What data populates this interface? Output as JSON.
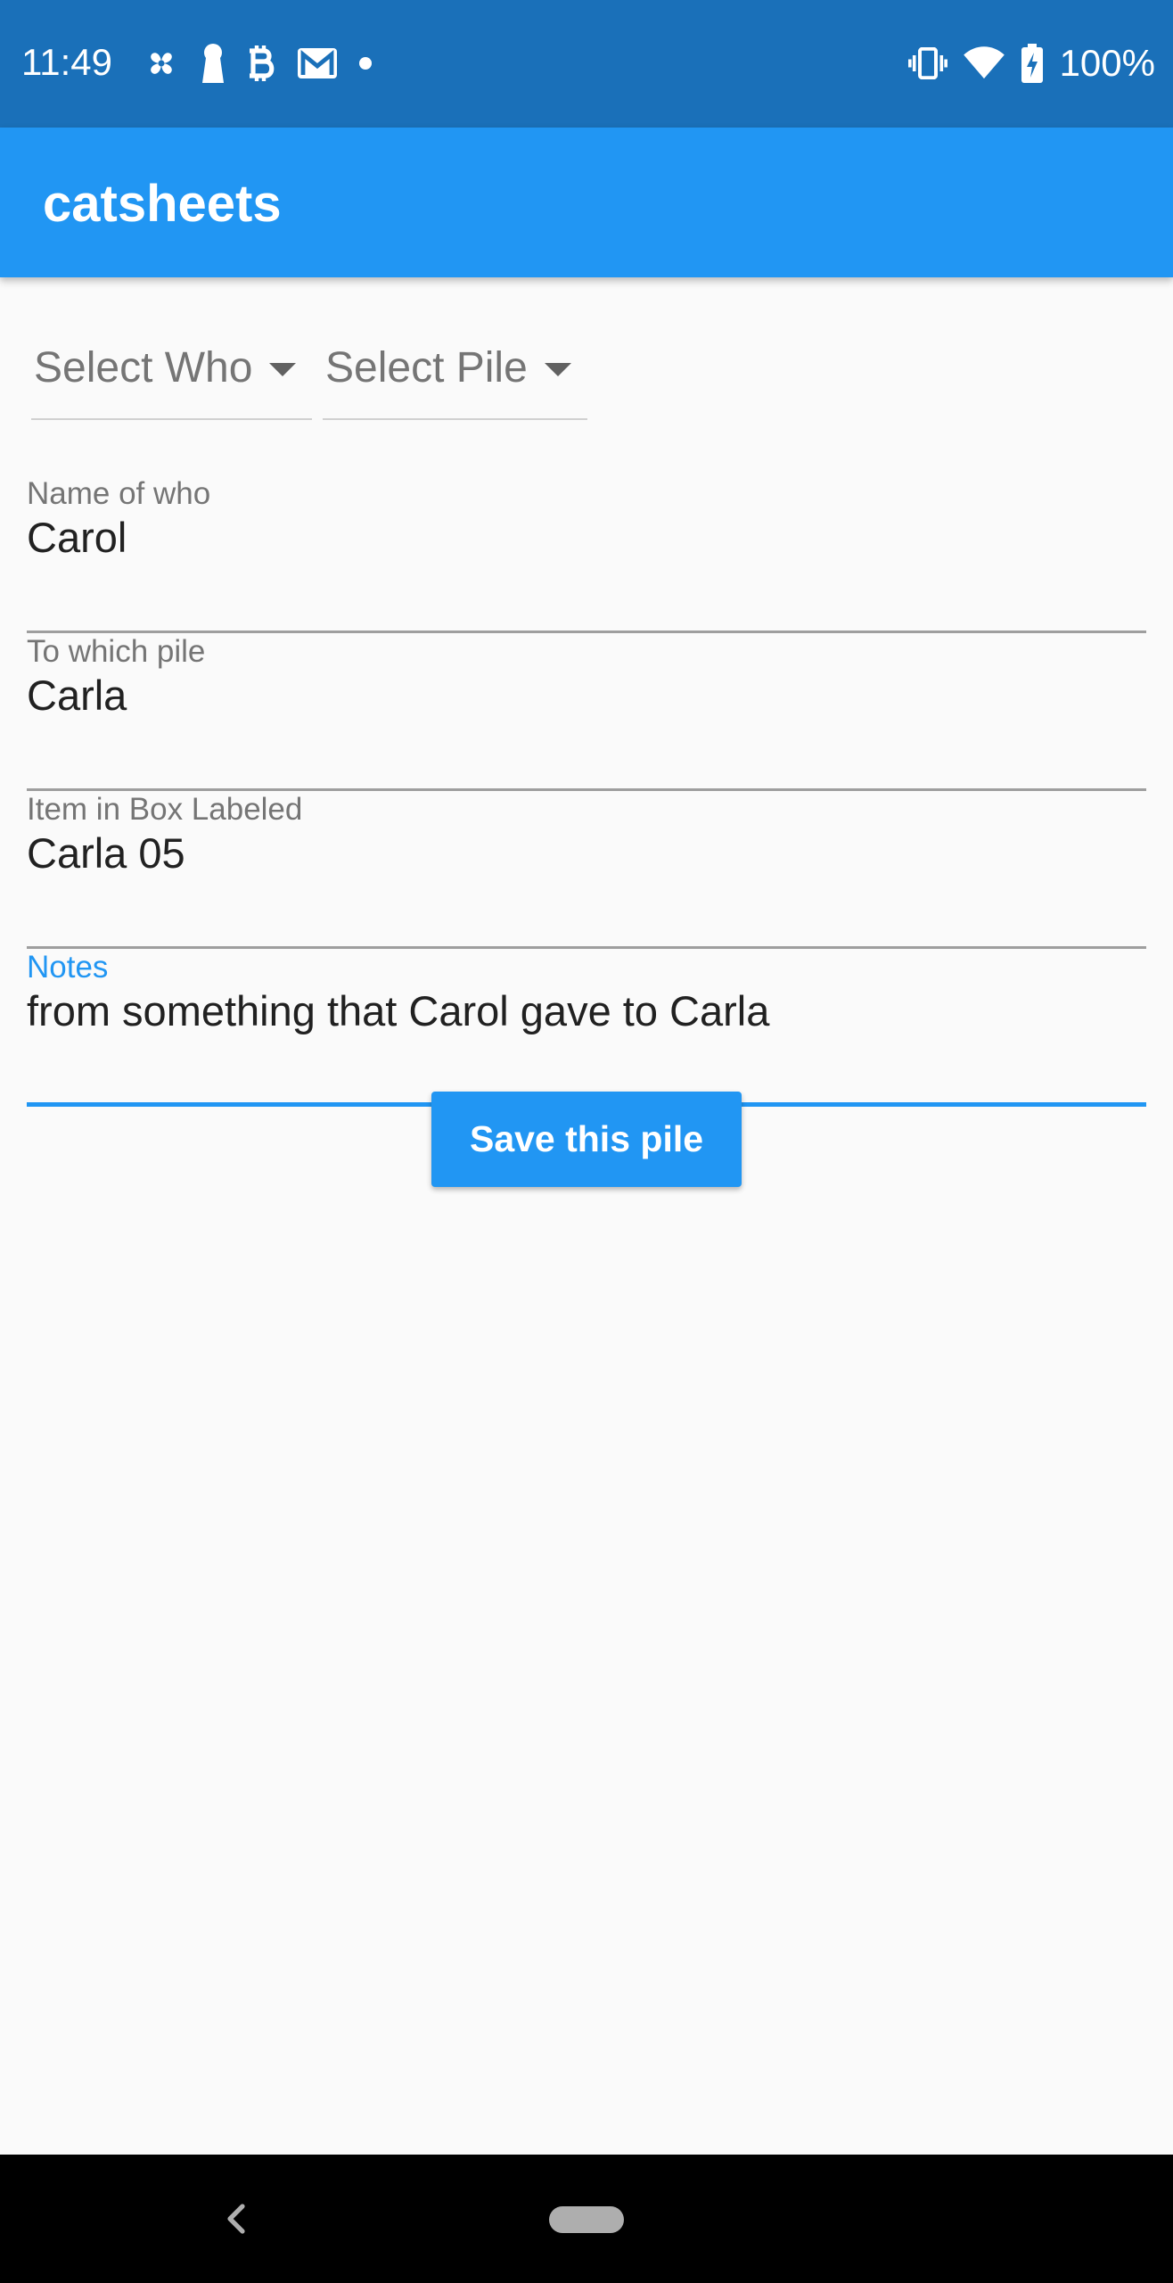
{
  "status_bar": {
    "time": "11:49",
    "left_icons": [
      "pinwheel-icon",
      "keyhole-icon",
      "bitcoin-icon",
      "gmail-icon",
      "dot-icon"
    ],
    "right_icons": [
      "vibrate-icon",
      "wifi-icon",
      "battery-charging-icon"
    ],
    "battery": "100%"
  },
  "app_bar": {
    "title": "catsheets"
  },
  "dropdowns": {
    "who": {
      "selected": "Select Who"
    },
    "pile": {
      "selected": "Select Pile"
    }
  },
  "fields": {
    "who": {
      "label": "Name of who",
      "value": "Carol"
    },
    "pile": {
      "label": "To which pile",
      "value": "Carla"
    },
    "box": {
      "label": "Item in Box Labeled",
      "value": "Carla 05"
    },
    "notes": {
      "label": "Notes",
      "value": "from something that Carol gave to Carla",
      "focused": true
    }
  },
  "save_button": {
    "label": "Save this pile"
  },
  "colors": {
    "status_bar": "#1a70b9",
    "app_bar": "#2196f3",
    "accent": "#2196f3",
    "background": "#fafafa",
    "nav_bar": "#000000"
  }
}
